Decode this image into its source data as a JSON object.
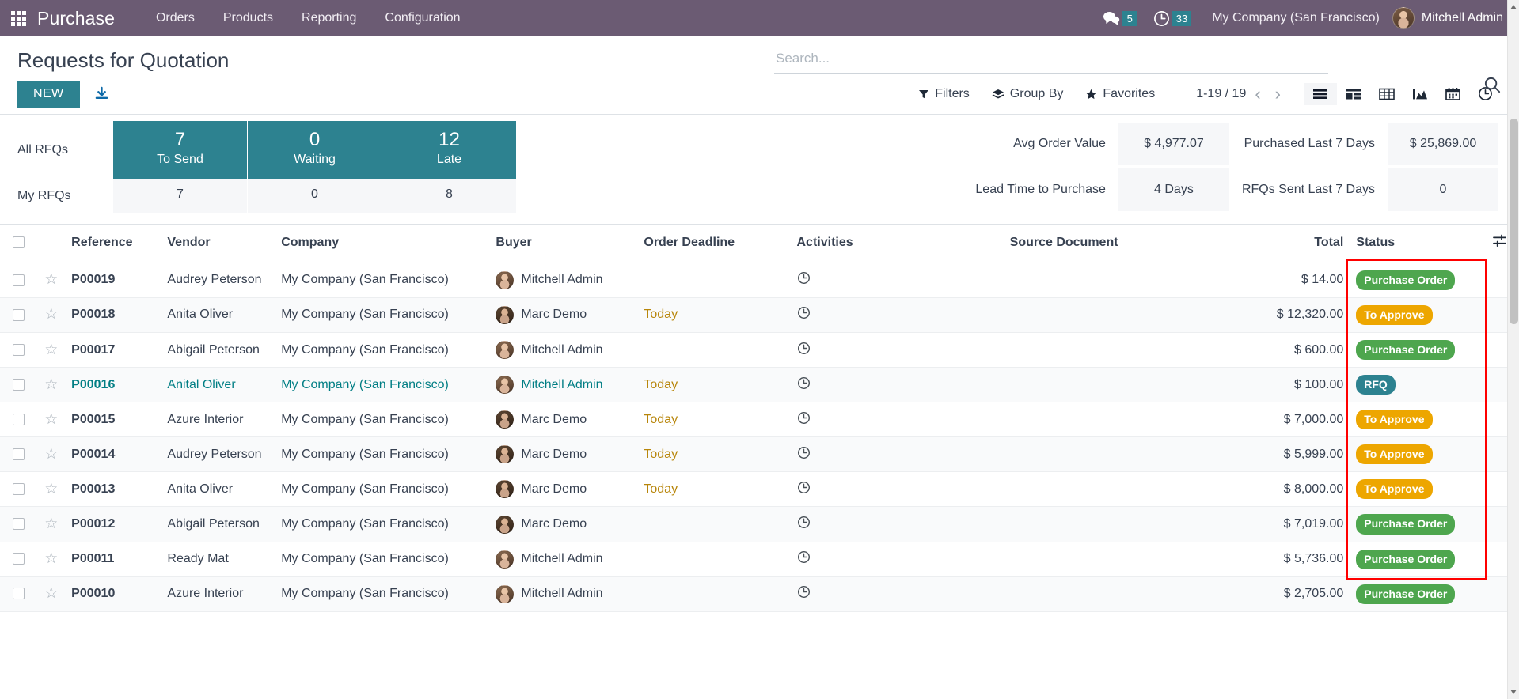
{
  "navbar": {
    "apps_icon": "apps-grid-icon",
    "brand": "Purchase",
    "menu": [
      {
        "label": "Orders"
      },
      {
        "label": "Products"
      },
      {
        "label": "Reporting"
      },
      {
        "label": "Configuration"
      }
    ],
    "messages_icon": "chat-bubble-icon",
    "messages_count": "5",
    "activities_icon": "clock-icon",
    "activities_count": "33",
    "company": "My Company (San Francisco)",
    "user": "Mitchell Admin",
    "avatar_icon": "user-avatar",
    "accent_color": "#6b5b73",
    "badge_color": "#2d8290"
  },
  "control_panel": {
    "title": "Requests for Quotation",
    "new_label": "NEW",
    "download_icon": "download-icon",
    "search_placeholder": "Search...",
    "search_value": "",
    "search_icon": "magnifier-icon",
    "filters_label": "Filters",
    "filters_icon": "funnel-icon",
    "groupby_label": "Group By",
    "groupby_icon": "layers-icon",
    "favorites_label": "Favorites",
    "favorites_icon": "star-icon",
    "pager": "1-19 / 19",
    "prev_icon": "chevron-left-icon",
    "next_icon": "chevron-right-icon",
    "views": [
      {
        "name": "list-view",
        "icon": "list-icon",
        "active": true
      },
      {
        "name": "kanban-view",
        "icon": "kanban-icon",
        "active": false
      },
      {
        "name": "pivot-view",
        "icon": "pivot-table-icon",
        "active": false
      },
      {
        "name": "graph-view",
        "icon": "area-chart-icon",
        "active": false
      },
      {
        "name": "calendar-view",
        "icon": "calendar-icon",
        "active": false
      },
      {
        "name": "activity-view",
        "icon": "clock-icon",
        "active": false
      }
    ]
  },
  "dashboard": {
    "row_labels": {
      "all": "All RFQs",
      "mine": "My RFQs"
    },
    "columns": [
      {
        "label": "To Send",
        "all": "7",
        "mine": "7"
      },
      {
        "label": "Waiting",
        "all": "0",
        "mine": "0"
      },
      {
        "label": "Late",
        "all": "12",
        "mine": "8"
      }
    ],
    "kpis": [
      {
        "label": "Avg Order Value",
        "value": "$ 4,977.07"
      },
      {
        "label": "Purchased Last 7 Days",
        "value": "$ 25,869.00"
      },
      {
        "label": "Lead Time to Purchase",
        "value": "4 Days"
      },
      {
        "label": "RFQs Sent Last 7 Days",
        "value": "0"
      }
    ]
  },
  "table": {
    "headers": {
      "select_all": "select-all-checkbox",
      "reference": "Reference",
      "vendor": "Vendor",
      "company": "Company",
      "buyer": "Buyer",
      "order_deadline": "Order Deadline",
      "activities": "Activities",
      "source_document": "Source Document",
      "total": "Total",
      "status": "Status",
      "options_icon": "column-options-icon"
    },
    "rows": [
      {
        "reference": "P00019",
        "vendor": "Audrey Peterson",
        "company": "My Company (San Francisco)",
        "buyer": "Mitchell Admin",
        "buyer_avatar": "av-mitchell",
        "deadline": "",
        "activity_icon": "clock-icon",
        "source": "",
        "total": "$ 14.00",
        "status": "Purchase Order",
        "status_class": "badge-po",
        "selected": false
      },
      {
        "reference": "P00018",
        "vendor": "Anita Oliver",
        "company": "My Company (San Francisco)",
        "buyer": "Marc Demo",
        "buyer_avatar": "av-marc",
        "deadline": "Today",
        "activity_icon": "clock-icon",
        "source": "",
        "total": "$ 12,320.00",
        "status": "To Approve",
        "status_class": "badge-appr",
        "selected": false
      },
      {
        "reference": "P00017",
        "vendor": "Abigail Peterson",
        "company": "My Company (San Francisco)",
        "buyer": "Mitchell Admin",
        "buyer_avatar": "av-mitchell",
        "deadline": "",
        "activity_icon": "clock-icon",
        "source": "",
        "total": "$ 600.00",
        "status": "Purchase Order",
        "status_class": "badge-po",
        "selected": false
      },
      {
        "reference": "P00016",
        "vendor": "Anital Oliver",
        "company": "My Company (San Francisco)",
        "buyer": "Mitchell Admin",
        "buyer_avatar": "av-mitchell",
        "deadline": "Today",
        "activity_icon": "clock-icon",
        "source": "",
        "total": "$ 100.00",
        "status": "RFQ",
        "status_class": "badge-rfq",
        "selected": true
      },
      {
        "reference": "P00015",
        "vendor": "Azure Interior",
        "company": "My Company (San Francisco)",
        "buyer": "Marc Demo",
        "buyer_avatar": "av-marc",
        "deadline": "Today",
        "activity_icon": "clock-icon",
        "source": "",
        "total": "$ 7,000.00",
        "status": "To Approve",
        "status_class": "badge-appr",
        "selected": false
      },
      {
        "reference": "P00014",
        "vendor": "Audrey Peterson",
        "company": "My Company (San Francisco)",
        "buyer": "Marc Demo",
        "buyer_avatar": "av-marc",
        "deadline": "Today",
        "activity_icon": "clock-icon",
        "source": "",
        "total": "$ 5,999.00",
        "status": "To Approve",
        "status_class": "badge-appr",
        "selected": false
      },
      {
        "reference": "P00013",
        "vendor": "Anita Oliver",
        "company": "My Company (San Francisco)",
        "buyer": "Marc Demo",
        "buyer_avatar": "av-marc",
        "deadline": "Today",
        "activity_icon": "clock-icon",
        "source": "",
        "total": "$ 8,000.00",
        "status": "To Approve",
        "status_class": "badge-appr",
        "selected": false
      },
      {
        "reference": "P00012",
        "vendor": "Abigail Peterson",
        "company": "My Company (San Francisco)",
        "buyer": "Marc Demo",
        "buyer_avatar": "av-marc",
        "deadline": "",
        "activity_icon": "clock-icon",
        "source": "",
        "total": "$ 7,019.00",
        "status": "Purchase Order",
        "status_class": "badge-po",
        "selected": false
      },
      {
        "reference": "P00011",
        "vendor": "Ready Mat",
        "company": "My Company (San Francisco)",
        "buyer": "Mitchell Admin",
        "buyer_avatar": "av-mitchell",
        "deadline": "",
        "activity_icon": "clock-icon",
        "source": "",
        "total": "$ 5,736.00",
        "status": "Purchase Order",
        "status_class": "badge-po",
        "selected": false
      },
      {
        "reference": "P00010",
        "vendor": "Azure Interior",
        "company": "My Company (San Francisco)",
        "buyer": "Mitchell Admin",
        "buyer_avatar": "av-mitchell",
        "deadline": "",
        "activity_icon": "clock-icon",
        "source": "",
        "total": "$ 2,705.00",
        "status": "Purchase Order",
        "status_class": "badge-po",
        "selected": false
      }
    ]
  },
  "annotation": {
    "name": "status-column-highlight",
    "color": "#ff0000"
  }
}
